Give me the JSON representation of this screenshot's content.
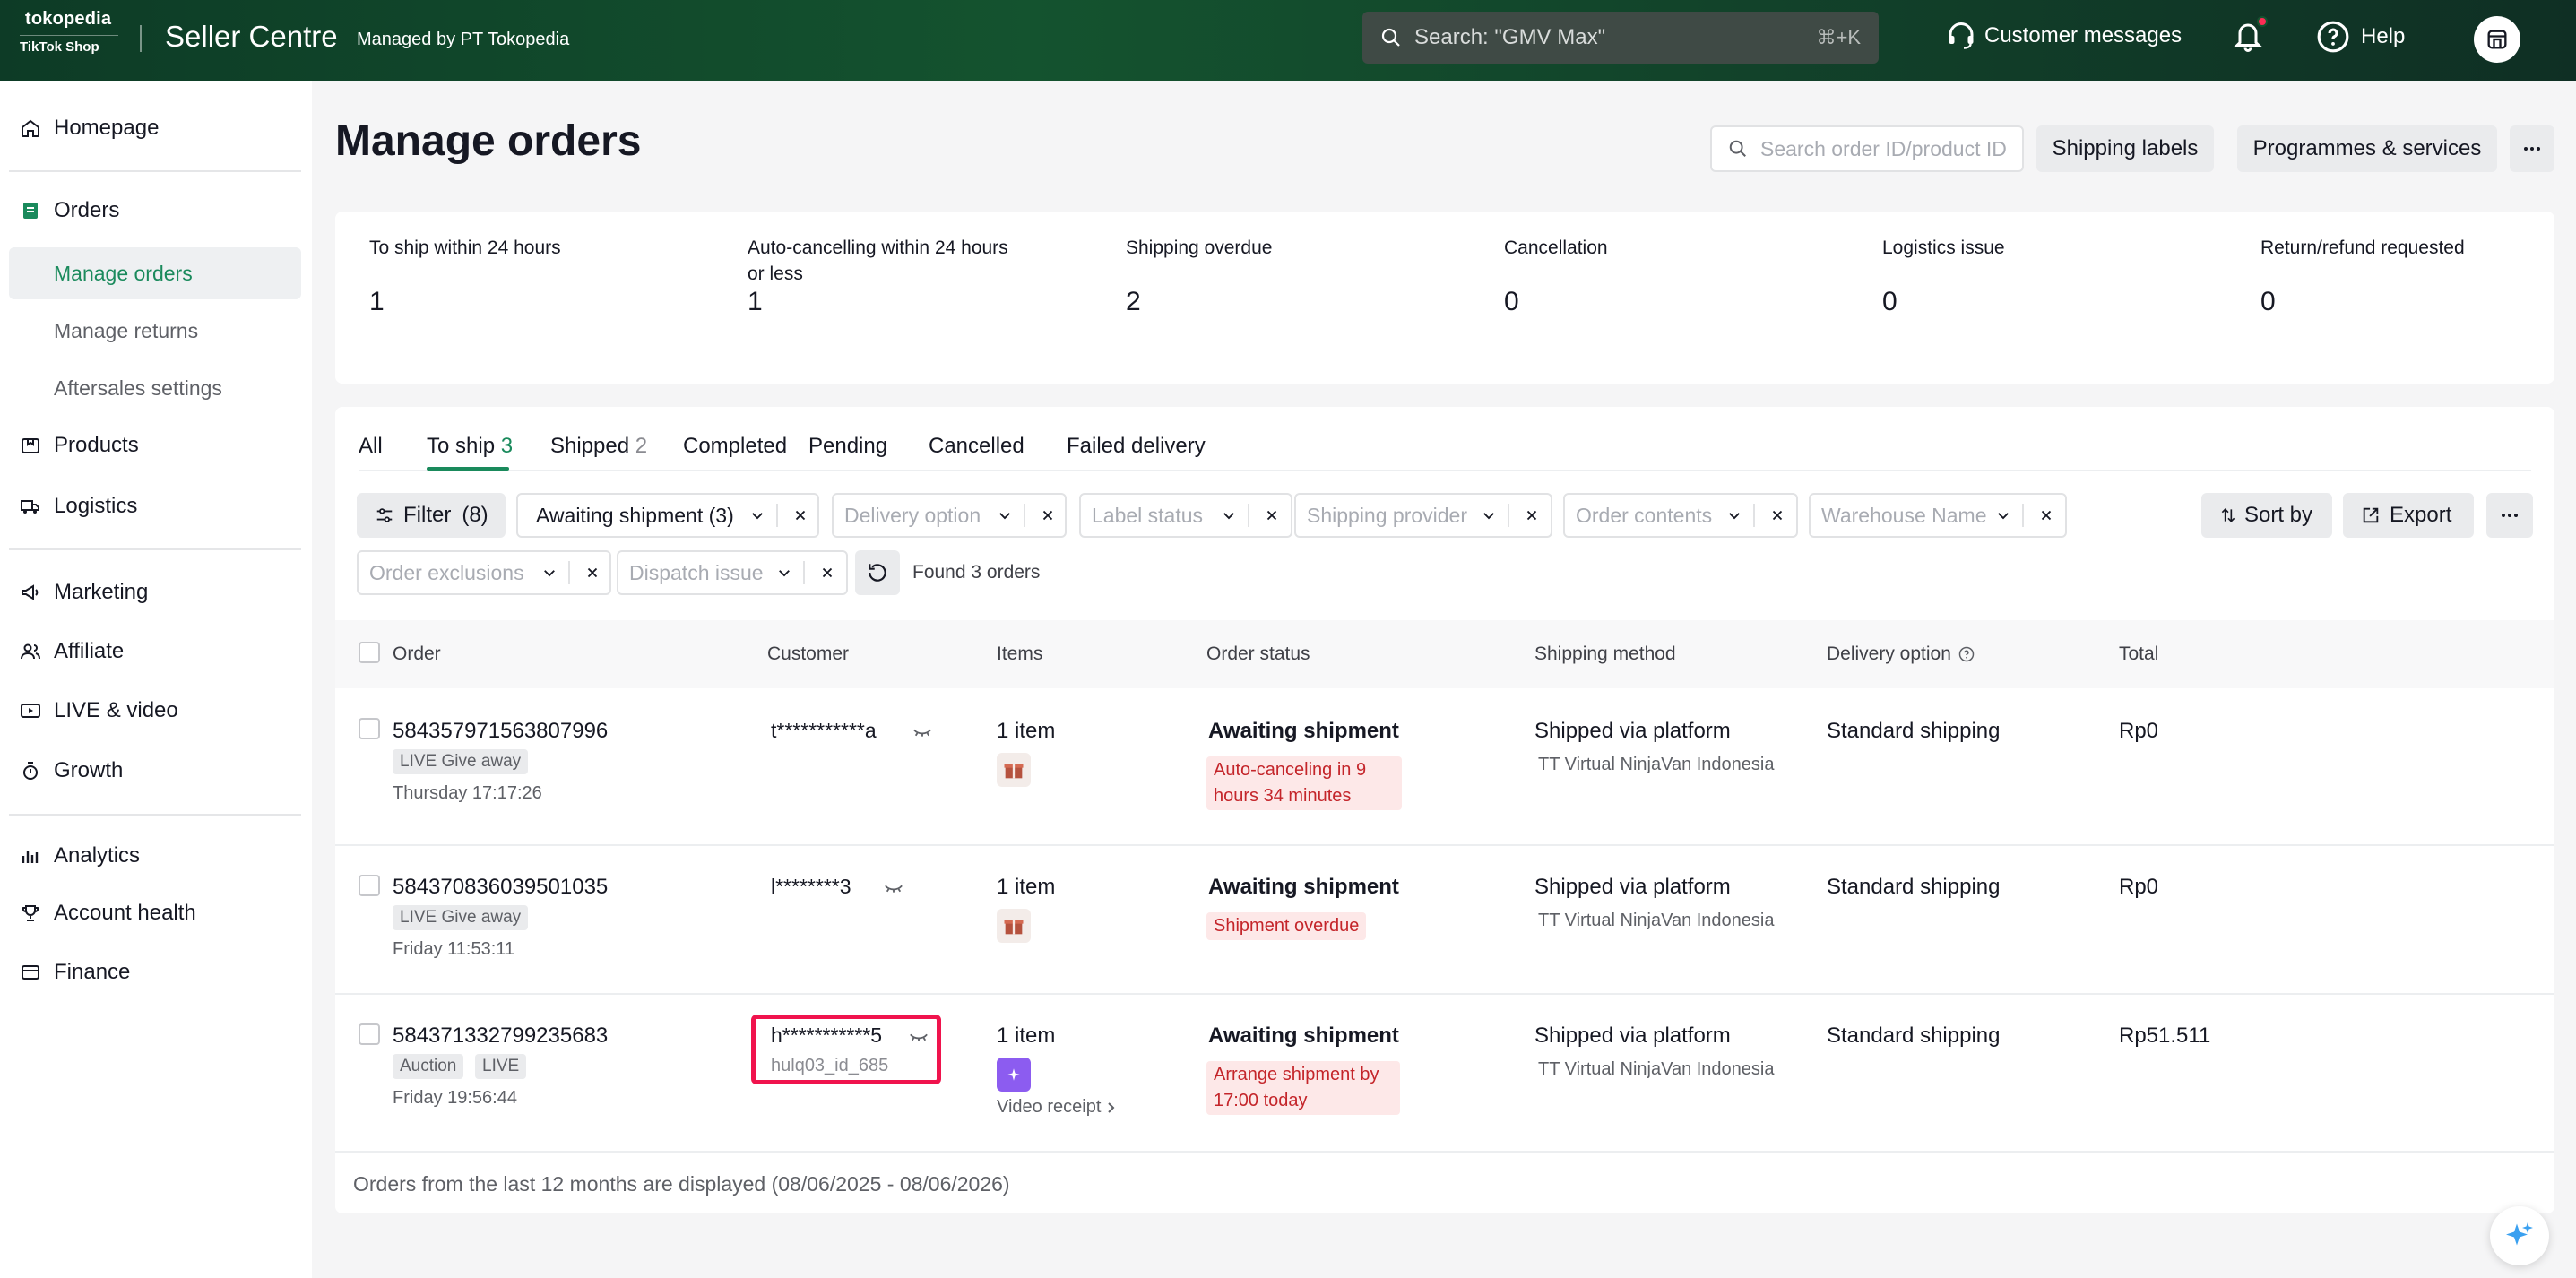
{
  "topbar": {
    "brand_line1": "tokopedia",
    "brand_line2": "TikTok Shop",
    "title": "Seller Centre",
    "subtitle": "Managed by PT Tokopedia",
    "search_placeholder": "Search: \"GMV Max\"",
    "search_shortcut": "⌘+K",
    "customer_messages": "Customer messages",
    "help": "Help"
  },
  "sidebar": {
    "homepage": "Homepage",
    "orders": "Orders",
    "manage_orders": "Manage orders",
    "manage_returns": "Manage returns",
    "aftersales_settings": "Aftersales settings",
    "products": "Products",
    "logistics": "Logistics",
    "marketing": "Marketing",
    "affiliate": "Affiliate",
    "live_video": "LIVE & video",
    "growth": "Growth",
    "analytics": "Analytics",
    "account_health": "Account health",
    "finance": "Finance"
  },
  "page": {
    "title": "Manage orders",
    "search_placeholder": "Search order ID/product ID",
    "shipping_labels": "Shipping labels",
    "programmes_services": "Programmes & services"
  },
  "stats": [
    {
      "label": "To ship within 24 hours",
      "value": "1"
    },
    {
      "label": "Auto-cancelling within 24 hours or less",
      "value": "1"
    },
    {
      "label": "Shipping overdue",
      "value": "2"
    },
    {
      "label": "Cancellation",
      "value": "0"
    },
    {
      "label": "Logistics issue",
      "value": "0"
    },
    {
      "label": "Return/refund requested",
      "value": "0"
    }
  ],
  "tabs": {
    "all": "All",
    "to_ship": "To ship",
    "to_ship_count": "3",
    "shipped": "Shipped",
    "shipped_count": "2",
    "completed": "Completed",
    "pending": "Pending",
    "cancelled": "Cancelled",
    "failed_delivery": "Failed delivery"
  },
  "filters": {
    "filter_label": "Filter",
    "filter_count": "(8)",
    "awaiting_shipment": "Awaiting shipment (3)",
    "delivery_option": "Delivery option",
    "label_status": "Label status",
    "shipping_provider": "Shipping provider",
    "order_contents": "Order contents",
    "warehouse_name": "Warehouse Name",
    "order_exclusions": "Order exclusions",
    "dispatch_issue": "Dispatch issue",
    "found": "Found 3 orders",
    "sort_by": "Sort by",
    "export": "Export"
  },
  "table": {
    "headers": {
      "order": "Order",
      "customer": "Customer",
      "items": "Items",
      "order_status": "Order status",
      "shipping_method": "Shipping method",
      "delivery_option": "Delivery option",
      "total": "Total"
    },
    "rows": [
      {
        "order_id": "584357971563807996",
        "tags": [
          "LIVE Give away"
        ],
        "time": "Thursday 17:17:26",
        "customer": "t***********a",
        "items": "1 item",
        "status": "Awaiting shipment",
        "status_note": "Auto-canceling in 9 hours 34 minutes",
        "shipping": "Shipped via platform",
        "carrier": "TT Virtual NinjaVan Indonesia",
        "delivery": "Standard shipping",
        "total": "Rp0"
      },
      {
        "order_id": "584370836039501035",
        "tags": [
          "LIVE Give away"
        ],
        "time": "Friday 11:53:11",
        "customer": "l********3",
        "items": "1 item",
        "status": "Awaiting shipment",
        "status_note": "Shipment overdue",
        "shipping": "Shipped via platform",
        "carrier": "TT Virtual NinjaVan Indonesia",
        "delivery": "Standard shipping",
        "total": "Rp0"
      },
      {
        "order_id": "584371332799235683",
        "tags": [
          "Auction",
          "LIVE"
        ],
        "time": "Friday 19:56:44",
        "customer": "h***********5",
        "customer_id": "hulq03_id_685",
        "items": "1 item",
        "video_receipt": "Video receipt",
        "status": "Awaiting shipment",
        "status_note": "Arrange shipment by 17:00 today",
        "shipping": "Shipped via platform",
        "carrier": "TT Virtual NinjaVan Indonesia",
        "delivery": "Standard shipping",
        "total": "Rp51.511"
      }
    ]
  },
  "footer_note": "Orders from the last 12 months are displayed (08/06/2025 - 08/06/2026)",
  "colors": {
    "accent": "#1a8a5c",
    "alert": "#c4252a",
    "highlight": "#f0134d"
  }
}
